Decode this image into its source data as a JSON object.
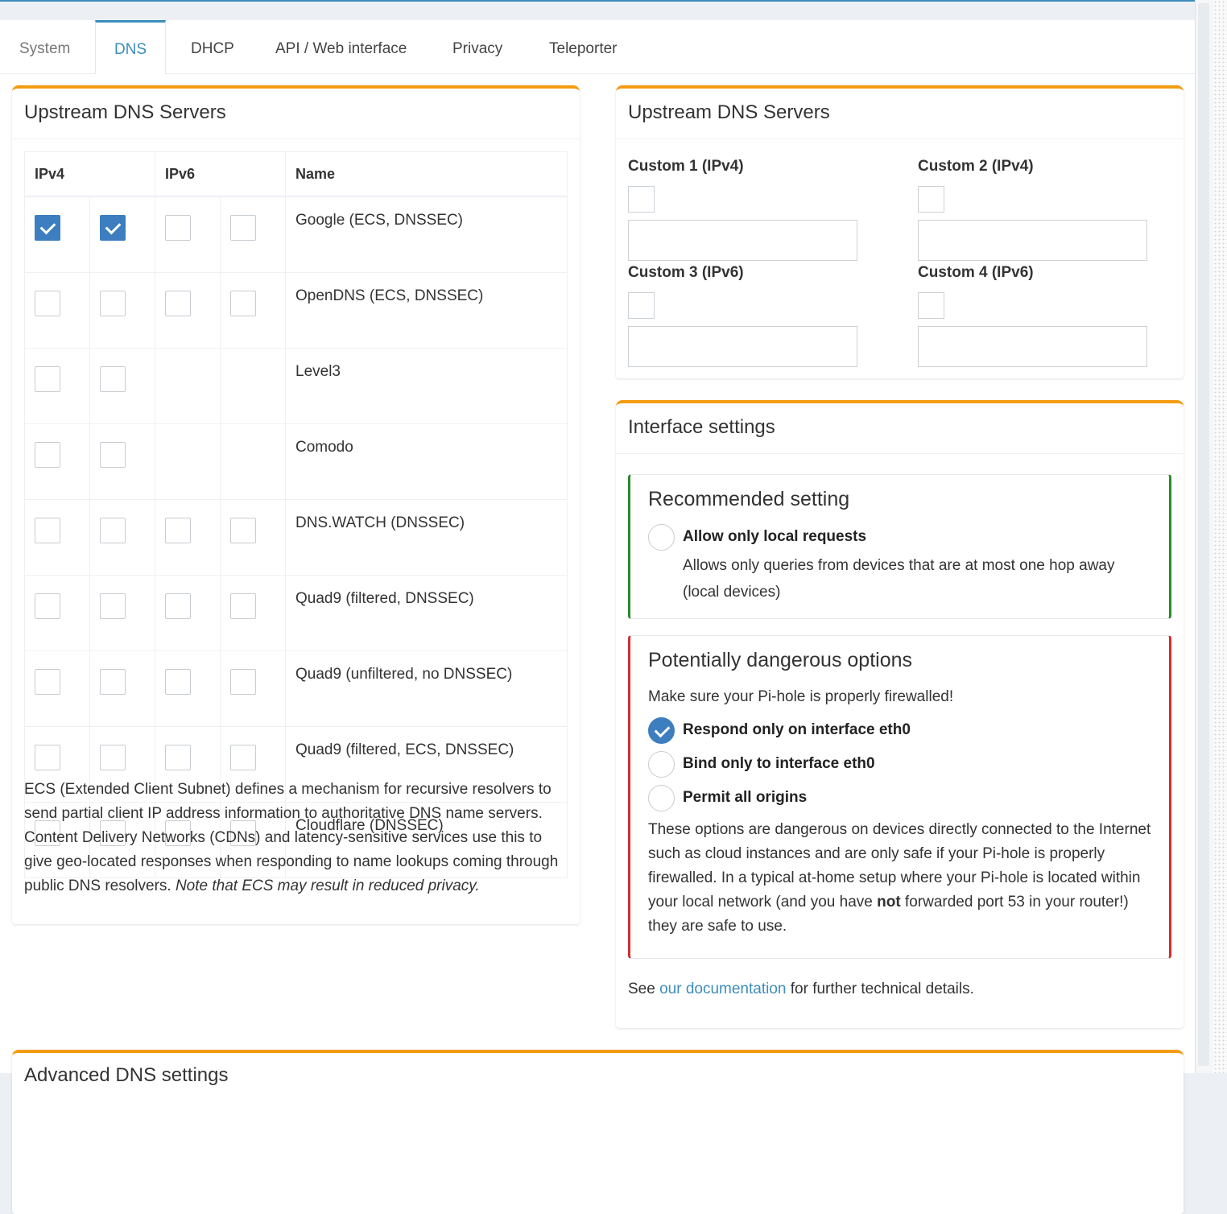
{
  "tabs": [
    {
      "label": "System"
    },
    {
      "label": "DNS"
    },
    {
      "label": "DHCP"
    },
    {
      "label": "API / Web interface"
    },
    {
      "label": "Privacy"
    },
    {
      "label": "Teleporter"
    }
  ],
  "upstream_list": {
    "title": "Upstream DNS Servers",
    "headers": {
      "ipv4": "IPv4",
      "ipv6": "IPv6",
      "name": "Name"
    },
    "servers": [
      {
        "name": "Google (ECS, DNSSEC)",
        "checks": [
          true,
          true,
          false,
          false
        ],
        "has_ipv6": true
      },
      {
        "name": "OpenDNS (ECS, DNSSEC)",
        "checks": [
          false,
          false,
          false,
          false
        ],
        "has_ipv6": true
      },
      {
        "name": "Level3",
        "checks": [
          false,
          false
        ],
        "has_ipv6": false
      },
      {
        "name": "Comodo",
        "checks": [
          false,
          false
        ],
        "has_ipv6": false
      },
      {
        "name": "DNS.WATCH (DNSSEC)",
        "checks": [
          false,
          false,
          false,
          false
        ],
        "has_ipv6": true
      },
      {
        "name": "Quad9 (filtered, DNSSEC)",
        "checks": [
          false,
          false,
          false,
          false
        ],
        "has_ipv6": true
      },
      {
        "name": "Quad9 (unfiltered, no DNSSEC)",
        "checks": [
          false,
          false,
          false,
          false
        ],
        "has_ipv6": true
      },
      {
        "name": "Quad9 (filtered, ECS, DNSSEC)",
        "checks": [
          false,
          false,
          false,
          false
        ],
        "has_ipv6": true
      },
      {
        "name": "Cloudflare (DNSSEC)",
        "checks": [
          false,
          false,
          false,
          false
        ],
        "has_ipv6": true
      }
    ],
    "ecs_text": "ECS (Extended Client Subnet) defines a mechanism for recursive resolvers to send partial client IP address information to authoritative DNS name servers. Content Delivery Networks (CDNs) and latency-sensitive services use this to give geo-located responses when responding to name lookups coming through public DNS resolvers.",
    "ecs_note": "Note that ECS may result in reduced privacy."
  },
  "upstream_custom": {
    "title": "Upstream DNS Servers",
    "custom1": "Custom 1 (IPv4)",
    "custom2": "Custom 2 (IPv4)",
    "custom3": "Custom 3 (IPv6)",
    "custom4": "Custom 4 (IPv6)"
  },
  "interface": {
    "title": "Interface settings",
    "recommended_title": "Recommended setting",
    "local_label": "Allow only local requests",
    "local_desc": "Allows only queries from devices that are at most one hop away (local devices)",
    "danger_title": "Potentially dangerous options",
    "danger_warning": "Make sure your Pi-hole is properly firewalled!",
    "opt_respond": "Respond only on interface eth0",
    "opt_bind": "Bind only to interface eth0",
    "opt_permit": "Permit all origins",
    "danger_desc_1": "These options are dangerous on devices directly connected to the Internet such as cloud instances and are only safe if your Pi-hole is properly firewalled. In a typical at-home setup where your Pi-hole is located within your local network (and you have ",
    "danger_desc_bold": "not",
    "danger_desc_2": " forwarded port 53 in your router!) they are safe to use.",
    "see_prefix": "See ",
    "see_link": "our documentation",
    "see_suffix": " for further technical details."
  },
  "advanced": {
    "title": "Advanced DNS settings"
  }
}
